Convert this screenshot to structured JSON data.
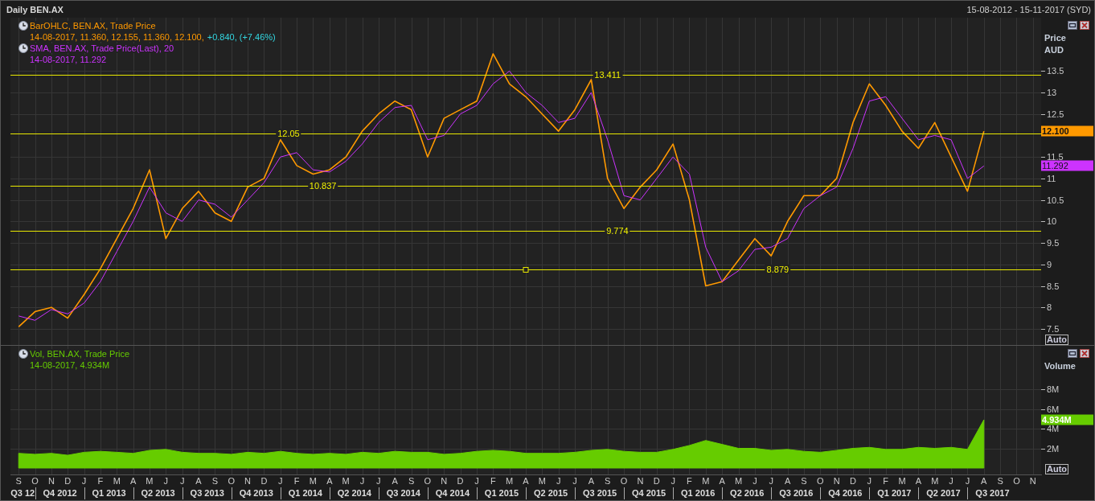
{
  "window": {
    "title": "Daily BEN.AX",
    "date_range": "15-08-2012 - 15-11-2017 (SYD)"
  },
  "price_pane": {
    "legend": [
      {
        "values": "14-08-2017, 11.360, 12.155, 11.360, 12.100,",
        "change": "+0.840, (+7.46%)"
      },
      {
        "values": "14-08-2017, 11.292"
      }
    ],
    "axis": {
      "title_lines": [
        "Price",
        "AUD"
      ],
      "tags": [
        {
          "text": "12.100",
          "color": "#ff9900"
        },
        {
          "text": "11.292",
          "color": "#cc33ff"
        }
      ],
      "auto": "Auto"
    },
    "chart_data": {
      "type": "line",
      "grid": true,
      "categories": [
        null,
        null,
        null,
        null,
        null,
        null,
        null,
        null,
        null,
        null,
        null,
        null,
        null,
        null,
        null,
        null,
        null,
        null,
        null,
        null,
        null,
        null,
        null,
        null,
        null,
        null,
        null,
        null,
        null,
        null,
        null,
        null,
        null,
        null,
        null,
        null,
        null,
        null,
        null,
        null,
        null,
        null,
        null,
        null,
        null,
        null,
        null,
        null,
        null,
        null,
        null,
        null,
        null,
        null,
        null,
        null,
        null,
        null,
        null,
        null,
        null,
        null,
        null
      ],
      "series": [
        {
          "name": "BarOHLC, BEN.AX, Trade Price",
          "color": "#ff9900",
          "values": [
            7.55,
            7.9,
            8.0,
            7.75,
            8.3,
            8.9,
            9.6,
            10.3,
            11.2,
            9.6,
            10.3,
            10.7,
            10.2,
            10.0,
            10.8,
            11.0,
            11.9,
            11.3,
            11.1,
            11.2,
            11.5,
            12.1,
            12.5,
            12.8,
            12.6,
            11.5,
            12.4,
            12.6,
            12.8,
            13.9,
            13.2,
            12.9,
            12.5,
            12.1,
            12.6,
            13.3,
            11.0,
            10.3,
            10.8,
            11.2,
            11.8,
            10.5,
            8.5,
            8.6,
            9.1,
            9.6,
            9.2,
            10.0,
            10.6,
            10.6,
            11.0,
            12.3,
            13.2,
            12.7,
            12.1,
            11.7,
            12.3,
            11.5,
            10.7,
            12.1,
            null,
            null,
            null
          ]
        },
        {
          "name": "SMA, BEN.AX, Trade Price(Last),  20",
          "color": "#cc33ff",
          "values": [
            7.8,
            7.7,
            7.95,
            7.85,
            8.1,
            8.6,
            9.3,
            10.0,
            10.8,
            10.2,
            10.0,
            10.5,
            10.4,
            10.1,
            10.5,
            10.9,
            11.5,
            11.6,
            11.2,
            11.15,
            11.4,
            11.8,
            12.3,
            12.65,
            12.7,
            11.9,
            12.0,
            12.5,
            12.7,
            13.2,
            13.5,
            13.0,
            12.7,
            12.3,
            12.4,
            13.0,
            11.9,
            10.6,
            10.5,
            11.0,
            11.5,
            11.1,
            9.4,
            8.6,
            8.85,
            9.35,
            9.4,
            9.6,
            10.3,
            10.6,
            10.8,
            11.7,
            12.8,
            12.9,
            12.4,
            11.9,
            12.0,
            11.9,
            11.0,
            11.29,
            null,
            null,
            null
          ]
        }
      ],
      "ylim": [
        7.125,
        14.74
      ],
      "yticks": [
        {
          "value": 7.5,
          "label": "7.5"
        },
        {
          "value": 8,
          "label": "8"
        },
        {
          "value": 8.5,
          "label": "8.5"
        },
        {
          "value": 9,
          "label": "9"
        },
        {
          "value": 9.5,
          "label": "9.5"
        },
        {
          "value": 10,
          "label": "10"
        },
        {
          "value": 10.5,
          "label": "10.5"
        },
        {
          "value": 11,
          "label": "11"
        },
        {
          "value": 11.5,
          "label": "11.5"
        },
        {
          "value": 12.5,
          "label": "12.5"
        },
        {
          "value": 13,
          "label": "13"
        },
        {
          "value": 13.5,
          "label": "13.5"
        }
      ],
      "ref_lines": [
        {
          "axis": "y",
          "value": 13.411,
          "label": "13.411"
        },
        {
          "axis": "y",
          "value": 12.05,
          "label": "12.05"
        },
        {
          "axis": "y",
          "value": 10.837,
          "label": "10.837"
        },
        {
          "axis": "y",
          "value": 9.774,
          "label": "9.774"
        },
        {
          "axis": "y",
          "value": 8.879,
          "label": "8.879"
        }
      ]
    },
    "level_lines": [
      {
        "selected": false
      },
      {
        "selected": false
      },
      {
        "selected": false
      },
      {
        "selected": false
      },
      {
        "selected": true
      }
    ]
  },
  "volume_pane": {
    "legend": [
      {
        "values": "14-08-2017, 4.934M"
      }
    ],
    "axis": {
      "title_lines": [
        "Volume"
      ],
      "tags": [
        {
          "text": "4.934M",
          "color": "#66cc00"
        }
      ],
      "auto": "Auto"
    },
    "chart_data": {
      "type": "area",
      "grid": true,
      "categories": [
        "S",
        "O",
        "N",
        "D",
        "J",
        "F",
        "M",
        "A",
        "M",
        "J",
        "J",
        "A",
        "S",
        "O",
        "N",
        "D",
        "J",
        "F",
        "M",
        "A",
        "M",
        "J",
        "J",
        "A",
        "S",
        "O",
        "N",
        "D",
        "J",
        "F",
        "M",
        "A",
        "M",
        "J",
        "J",
        "A",
        "S",
        "O",
        "N",
        "D",
        "J",
        "F",
        "M",
        "A",
        "M",
        "J",
        "J",
        "A",
        "S",
        "O",
        "N",
        "D",
        "J",
        "F",
        "M",
        "A",
        "M",
        "J",
        "J",
        "A",
        "S",
        "O",
        "N"
      ],
      "series": [
        {
          "name": "Vol, BEN.AX, Trade Price",
          "color": "#66cc00",
          "values": [
            1.5,
            1.4,
            1.5,
            1.3,
            1.6,
            1.7,
            1.6,
            1.5,
            1.8,
            1.9,
            1.6,
            1.5,
            1.5,
            1.4,
            1.6,
            1.5,
            1.7,
            1.5,
            1.4,
            1.5,
            1.4,
            1.6,
            1.5,
            1.7,
            1.6,
            1.6,
            1.4,
            1.5,
            1.7,
            1.8,
            1.7,
            1.5,
            1.5,
            1.5,
            1.6,
            1.8,
            1.9,
            1.7,
            1.6,
            1.6,
            1.9,
            2.3,
            2.8,
            2.4,
            2.0,
            2.0,
            1.8,
            1.9,
            1.7,
            1.6,
            1.8,
            2.0,
            2.1,
            1.9,
            1.9,
            2.1,
            2.0,
            2.1,
            1.9,
            4.9,
            null,
            null,
            null
          ]
        }
      ],
      "ylim": [
        -0.65,
        12.41
      ],
      "yticks": [
        {
          "value": 2,
          "label": "2M"
        },
        {
          "value": 4,
          "label": "4M"
        },
        {
          "value": 6,
          "label": "6M"
        },
        {
          "value": 8,
          "label": "8M"
        }
      ]
    }
  },
  "time_axis": {
    "quarters": [
      "Q3 12",
      "Q4 2012",
      "Q1 2013",
      "Q2 2013",
      "Q3 2013",
      "Q4 2013",
      "Q1 2014",
      "Q2 2014",
      "Q3 2014",
      "Q4 2014",
      "Q1 2015",
      "Q2 2015",
      "Q3 2015",
      "Q4 2015",
      "Q1 2016",
      "Q2 2016",
      "Q3 2016",
      "Q4 2016",
      "Q1 2017",
      "Q2 2017",
      "Q3 2017"
    ]
  }
}
